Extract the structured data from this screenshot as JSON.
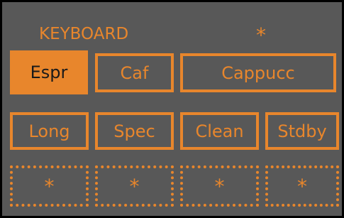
{
  "header": {
    "title": "KEYBOARD",
    "status_icon": "*"
  },
  "keys": {
    "row1": [
      {
        "label": "Espr",
        "active": true
      },
      {
        "label": "Caf",
        "active": false
      },
      {
        "label": "Cappucc",
        "active": false
      }
    ],
    "row2": [
      {
        "label": "Long"
      },
      {
        "label": "Spec"
      },
      {
        "label": "Clean"
      },
      {
        "label": "Stdby"
      }
    ],
    "row3": [
      {
        "label": "*"
      },
      {
        "label": "*"
      },
      {
        "label": "*"
      },
      {
        "label": "*"
      }
    ]
  },
  "colors": {
    "background": "#585858",
    "accent": "#e8862c",
    "active_text": "#1a1a1a"
  }
}
